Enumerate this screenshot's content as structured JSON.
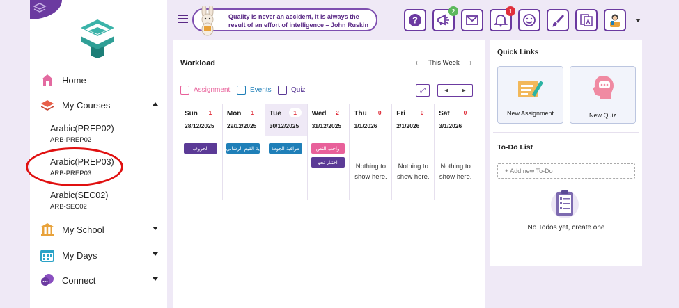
{
  "sidebar": {
    "nav": [
      {
        "label": "Home",
        "icon": "home-icon"
      },
      {
        "label": "My Courses",
        "icon": "layers-icon"
      },
      {
        "label": "My School",
        "icon": "school-icon"
      },
      {
        "label": "My Days",
        "icon": "calendar-icon"
      },
      {
        "label": "Connect",
        "icon": "chat-icon"
      }
    ],
    "courses": [
      {
        "name": "Arabic(PREP02)",
        "code": "ARB-PREP02"
      },
      {
        "name": "Arabic(PREP03)",
        "code": "ARB-PREP03"
      },
      {
        "name": "Arabic(SEC02)",
        "code": "ARB-SEC02"
      }
    ]
  },
  "topbar": {
    "quote": "Quality is never an accident, it is always the result of an effort of intelligence – John Ruskin",
    "badges": {
      "announcements": "2",
      "notifications": "1"
    }
  },
  "workload": {
    "title": "Workload",
    "range_label": "This Week",
    "filters": [
      "Assignment",
      "Events",
      "Quiz"
    ],
    "days": [
      {
        "day": "Sun",
        "count": "1",
        "date": "28/12/2025"
      },
      {
        "day": "Mon",
        "count": "1",
        "date": "29/12/2025"
      },
      {
        "day": "Tue",
        "count": "1",
        "date": "30/12/2025"
      },
      {
        "day": "Wed",
        "count": "2",
        "date": "31/12/2025"
      },
      {
        "day": "Thu",
        "count": "0",
        "date": "1/1/2026"
      },
      {
        "day": "Fri",
        "count": "0",
        "date": "2/1/2026"
      },
      {
        "day": "Sat",
        "count": "0",
        "date": "3/1/2026"
      }
    ],
    "chips": {
      "sun": "الحروف",
      "mon": "ية القيم الرشاني",
      "tue": "مراقبة الجودة",
      "wed1": "واجب النص",
      "wed2": "اختبار نحو"
    },
    "empty_text": "Nothing to show here."
  },
  "quick_links": {
    "title": "Quick Links",
    "items": [
      "New Assignment",
      "New Quiz"
    ]
  },
  "todo": {
    "title": "To-Do List",
    "placeholder": "+ Add new To-Do",
    "empty": "No Todos yet, create one"
  },
  "colors": {
    "primary": "#6b3aa0",
    "assignment": "#e8609a",
    "events": "#1f7fb8",
    "quiz": "#5b3a96",
    "badge_green": "#5cb85c",
    "badge_red": "#e0303c"
  }
}
